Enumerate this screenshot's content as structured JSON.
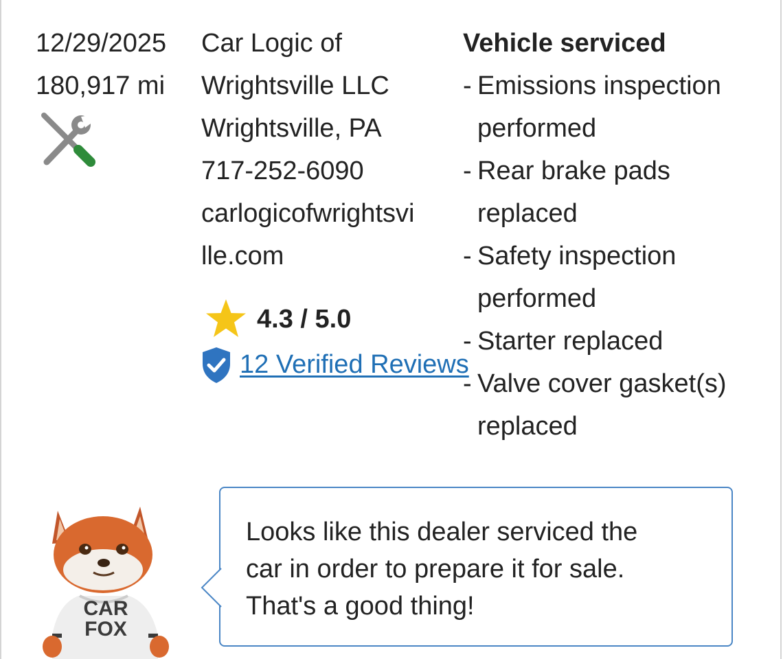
{
  "record": {
    "date": "12/29/2025",
    "mileage": "180,917 mi",
    "record_type_icon": "tools-icon"
  },
  "dealer": {
    "name_line1": "Car Logic of",
    "name_line2": "Wrightsville LLC",
    "location": "Wrightsville, PA",
    "phone": "717-252-6090",
    "website_line1": "carlogicofwrightsvi",
    "website_line2": "lle.com",
    "rating": "4.3 / 5.0",
    "rating_value": 4.3,
    "rating_max": 5.0,
    "reviews_link": "12 Verified Reviews",
    "star_color": "#f5c518",
    "link_color": "#1f6fb5"
  },
  "service": {
    "title": "Vehicle serviced",
    "items": [
      {
        "dash": "-",
        "line1": "Emissions inspection",
        "line2": "performed"
      },
      {
        "dash": "-",
        "line1": "Rear brake pads",
        "line2": "replaced"
      },
      {
        "dash": "-",
        "line1": "Safety inspection",
        "line2": "performed"
      },
      {
        "dash": "-",
        "line1": "Starter replaced",
        "line2": ""
      },
      {
        "dash": "-",
        "line1": "Valve cover gasket(s)",
        "line2": "replaced"
      }
    ]
  },
  "carfox": {
    "shirt_line1": "CAR",
    "shirt_line2": "FOX",
    "message_line1": "Looks like this dealer serviced the",
    "message_line2": "car in order to prepare it for sale.",
    "message_line3": "That's a good thing!"
  }
}
